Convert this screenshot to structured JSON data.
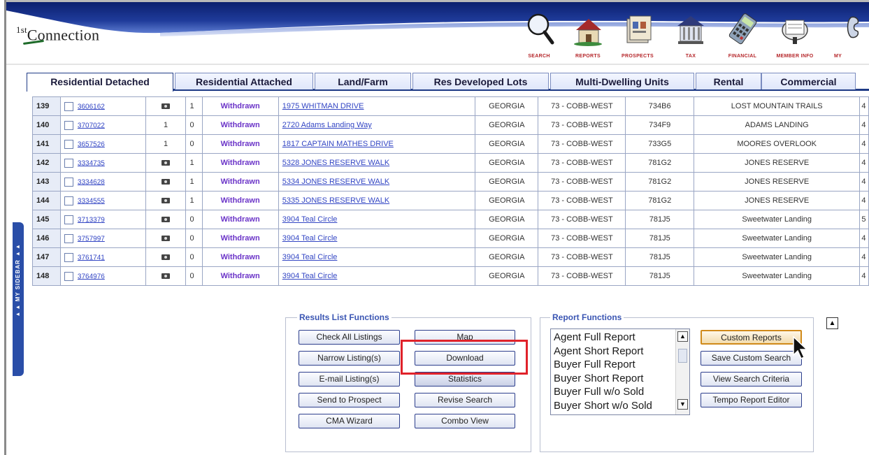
{
  "header": {
    "logo": {
      "sup": "1st",
      "text": "Connection"
    },
    "nav": [
      {
        "label": "SEARCH",
        "icon": "magnifier-icon"
      },
      {
        "label": "REPORTS",
        "icon": "house-icon"
      },
      {
        "label": "PROSPECTS",
        "icon": "prospects-icon"
      },
      {
        "label": "TAX",
        "icon": "courthouse-icon"
      },
      {
        "label": "FINANCIAL",
        "icon": "calculator-icon"
      },
      {
        "label": "MEMBER INFO",
        "icon": "rolodex-icon"
      },
      {
        "label": "MY",
        "icon": "phone-icon"
      }
    ]
  },
  "tabs": [
    {
      "label": "Residential Detached",
      "active": true
    },
    {
      "label": "Residential Attached"
    },
    {
      "label": "Land/Farm"
    },
    {
      "label": "Res Developed Lots"
    },
    {
      "label": "Multi-Dwelling Units"
    },
    {
      "label": "Rental"
    },
    {
      "label": "Commercial"
    }
  ],
  "sidebar": {
    "label": "▸▸ MY SIDEBAR ▸▸"
  },
  "results": {
    "rows": [
      {
        "num": "139",
        "id": "3606162",
        "photo": "camera",
        "count": "1",
        "status": "Withdrawn",
        "address": "1975 WHITMAN DRIVE",
        "county": "GEORGIA",
        "area": "73 - COBB-WEST",
        "grid": "734B6",
        "subdivision": "LOST MOUNTAIN TRAILS",
        "extra": "4"
      },
      {
        "num": "140",
        "id": "3707022",
        "photo": "1",
        "count": "0",
        "status": "Withdrawn",
        "address": "2720 Adams Landing Way",
        "county": "GEORGIA",
        "area": "73 - COBB-WEST",
        "grid": "734F9",
        "subdivision": "ADAMS LANDING",
        "extra": "4"
      },
      {
        "num": "141",
        "id": "3657526",
        "photo": "1",
        "count": "0",
        "status": "Withdrawn",
        "address": "1817 CAPTAIN MATHES DRIVE",
        "county": "GEORGIA",
        "area": "73 - COBB-WEST",
        "grid": "733G5",
        "subdivision": "MOORES OVERLOOK",
        "extra": "4"
      },
      {
        "num": "142",
        "id": "3334735",
        "photo": "camera",
        "count": "1",
        "status": "Withdrawn",
        "address": "5328 JONES RESERVE WALK",
        "county": "GEORGIA",
        "area": "73 - COBB-WEST",
        "grid": "781G2",
        "subdivision": "JONES RESERVE",
        "extra": "4"
      },
      {
        "num": "143",
        "id": "3334628",
        "photo": "camera",
        "count": "1",
        "status": "Withdrawn",
        "address": "5334 JONES RESERVE WALK",
        "county": "GEORGIA",
        "area": "73 - COBB-WEST",
        "grid": "781G2",
        "subdivision": "JONES RESERVE",
        "extra": "4"
      },
      {
        "num": "144",
        "id": "3334555",
        "photo": "camera",
        "count": "1",
        "status": "Withdrawn",
        "address": "5335 JONES RESERVE WALK",
        "county": "GEORGIA",
        "area": "73 - COBB-WEST",
        "grid": "781G2",
        "subdivision": "JONES RESERVE",
        "extra": "4"
      },
      {
        "num": "145",
        "id": "3713379",
        "photo": "camera",
        "count": "0",
        "status": "Withdrawn",
        "address": "3904 Teal Circle",
        "county": "GEORGIA",
        "area": "73 - COBB-WEST",
        "grid": "781J5",
        "subdivision": "Sweetwater Landing",
        "extra": "5"
      },
      {
        "num": "146",
        "id": "3757997",
        "photo": "camera",
        "count": "0",
        "status": "Withdrawn",
        "address": "3904 Teal Circle",
        "county": "GEORGIA",
        "area": "73 - COBB-WEST",
        "grid": "781J5",
        "subdivision": "Sweetwater Landing",
        "extra": "4"
      },
      {
        "num": "147",
        "id": "3761741",
        "photo": "camera",
        "count": "0",
        "status": "Withdrawn",
        "address": "3904 Teal Circle",
        "county": "GEORGIA",
        "area": "73 - COBB-WEST",
        "grid": "781J5",
        "subdivision": "Sweetwater Landing",
        "extra": "4"
      },
      {
        "num": "148",
        "id": "3764976",
        "photo": "camera",
        "count": "0",
        "status": "Withdrawn",
        "address": "3904 Teal Circle",
        "county": "GEORGIA",
        "area": "73 - COBB-WEST",
        "grid": "781J5",
        "subdivision": "Sweetwater Landing",
        "extra": "4"
      }
    ]
  },
  "results_functions": {
    "title": "Results List Functions",
    "buttons": {
      "check_all": "Check All Listings",
      "map": "Map",
      "narrow": "Narrow Listing(s)",
      "download": "Download",
      "email": "E-mail Listing(s)",
      "statistics": "Statistics",
      "send_prospect": "Send to Prospect",
      "revise": "Revise Search",
      "cma": "CMA Wizard",
      "combo": "Combo View"
    }
  },
  "report_functions": {
    "title": "Report Functions",
    "list": [
      "Agent Full Report",
      "Agent Short Report",
      "Buyer Full Report",
      "Buyer Short Report",
      "Buyer Full w/o Sold",
      "Buyer Short w/o Sold"
    ],
    "buttons": {
      "custom_reports": "Custom Reports",
      "save_custom_search": "Save Custom Search",
      "view_criteria": "View Search Criteria",
      "tempo_editor": "Tempo Report Editor"
    }
  },
  "colors": {
    "brand_blue": "#1f3b86",
    "status_purple": "#6b34c8",
    "link_blue": "#3346c4",
    "highlight_red": "#e0222a"
  }
}
